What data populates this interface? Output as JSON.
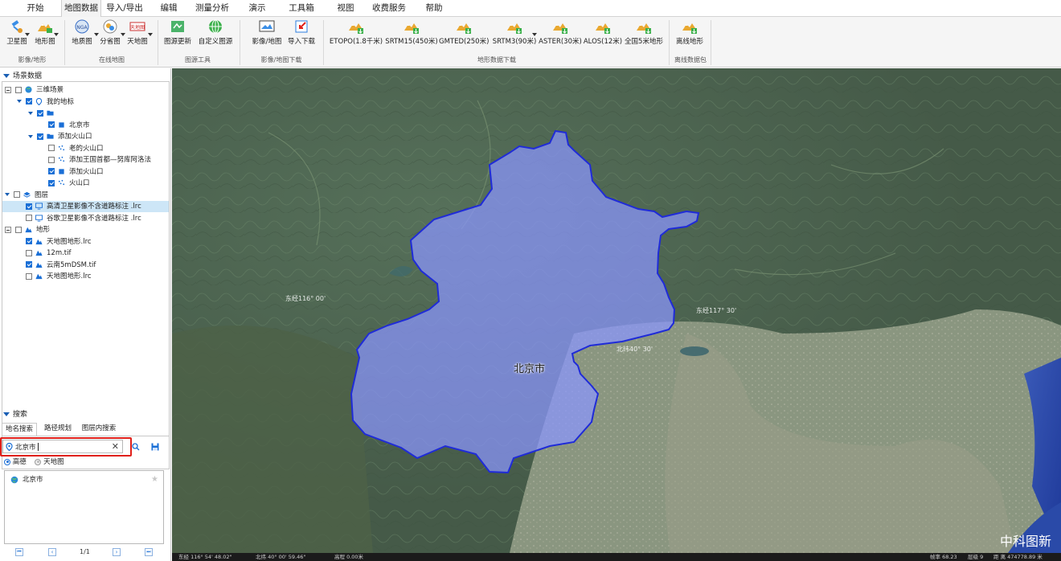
{
  "menu": [
    {
      "label": "开始",
      "active": false
    },
    {
      "label": "地图数据",
      "active": true
    },
    {
      "label": "导入/导出",
      "active": false
    },
    {
      "label": "编辑",
      "active": false
    },
    {
      "label": "测量分析",
      "active": false
    },
    {
      "label": "演示",
      "active": false
    },
    {
      "label": "工具箱",
      "active": false
    },
    {
      "label": "视图",
      "active": false
    },
    {
      "label": "收费服务",
      "active": false
    },
    {
      "label": "帮助",
      "active": false
    }
  ],
  "ribbon": {
    "buttons": [
      {
        "label": "卫星图",
        "icon": "satellite-icon"
      },
      {
        "label": "地形图",
        "icon": "terrain-icon"
      },
      {
        "label": "地质图",
        "icon": "geology-icon"
      },
      {
        "label": "分省图",
        "icon": "province-icon"
      },
      {
        "label": "天地图",
        "icon": "tianditu-icon"
      },
      {
        "label": "图源更新",
        "icon": "map-update-icon"
      },
      {
        "label": "自定义图源",
        "icon": "custom-source-icon"
      },
      {
        "label": "影像/地图",
        "icon": "image-map-icon"
      },
      {
        "label": "导入下载",
        "icon": "import-download-icon"
      },
      {
        "label": "ETOPO(1.8千米)",
        "icon": "terrain-download-icon"
      },
      {
        "label": "SRTM15(450米)",
        "icon": "terrain-download-icon"
      },
      {
        "label": "GMTED(250米)",
        "icon": "terrain-download-icon"
      },
      {
        "label": "SRTM3(90米)",
        "icon": "terrain-download-icon"
      },
      {
        "label": "ASTER(30米)",
        "icon": "terrain-download-icon"
      },
      {
        "label": "ALOS(12米)",
        "icon": "terrain-download-icon"
      },
      {
        "label": "全国5米地形",
        "icon": "terrain-download-icon"
      },
      {
        "label": "离线地形",
        "icon": "terrain-download-icon"
      }
    ],
    "groups": [
      "影像/地形",
      "在线地图",
      "图源工具",
      "影像/地图下载",
      "地形数据下载",
      "离线数据包"
    ]
  },
  "scene": {
    "header": "场景数据",
    "tree": [
      {
        "label": "三维场景",
        "level": 0,
        "check": false,
        "expand": "box",
        "icon": "globe-icon"
      },
      {
        "label": "我的地标",
        "level": 1,
        "check": true,
        "expand": "tri",
        "icon": "pin-icon"
      },
      {
        "label": "",
        "level": 2,
        "check": true,
        "expand": "tri",
        "icon": "folder-icon"
      },
      {
        "label": "北京市",
        "level": 3,
        "check": true,
        "expand": "",
        "icon": "polygon-icon"
      },
      {
        "label": "添加火山口",
        "level": 2,
        "check": true,
        "expand": "tri",
        "icon": "folder-icon"
      },
      {
        "label": "老的火山口",
        "level": 3,
        "check": false,
        "expand": "",
        "icon": "point-icon"
      },
      {
        "label": "添加王国首都—努库阿洛法",
        "level": 3,
        "check": false,
        "expand": "",
        "icon": "point-icon"
      },
      {
        "label": "添加火山口",
        "level": 3,
        "check": true,
        "expand": "",
        "icon": "polygon-icon"
      },
      {
        "label": "火山口",
        "level": 3,
        "check": true,
        "expand": "",
        "icon": "point-icon"
      },
      {
        "label": "图层",
        "level": 0,
        "check": false,
        "expand": "tri",
        "icon": "layers-icon"
      },
      {
        "label": "高清卫星影像不含道路标注 .lrc",
        "level": 1,
        "check": true,
        "expand": "",
        "icon": "monitor-icon",
        "selected": true
      },
      {
        "label": "谷歌卫星影像不含道路标注 .lrc",
        "level": 1,
        "check": false,
        "expand": "",
        "icon": "monitor-icon"
      },
      {
        "label": "地形",
        "level": 0,
        "check": false,
        "expand": "box",
        "icon": "terrain-icon"
      },
      {
        "label": "天地图地形.lrc",
        "level": 1,
        "check": true,
        "expand": "",
        "icon": "terrain-icon"
      },
      {
        "label": "12m.tif",
        "level": 1,
        "check": false,
        "expand": "",
        "icon": "terrain-icon"
      },
      {
        "label": "云南5mDSM.tif",
        "level": 1,
        "check": true,
        "expand": "",
        "icon": "terrain-icon"
      },
      {
        "label": "天地图地形.lrc",
        "level": 1,
        "check": false,
        "expand": "",
        "icon": "terrain-icon"
      }
    ]
  },
  "search": {
    "header": "搜索",
    "tabs": [
      "地名搜索",
      "路径规划",
      "图层内搜索"
    ],
    "input_value": "北京市",
    "sources": [
      "高德",
      "天地图"
    ],
    "selected_source": "高德",
    "results": [
      {
        "label": "北京市"
      }
    ],
    "pager": "1/1"
  },
  "map": {
    "region_label": "北京市",
    "coord_labels": [
      "东经116° 00'",
      "东经117° 30'",
      "北纬40° 30'"
    ],
    "watermark": "中科图新",
    "boundary_color": "#1f2bd8",
    "fill_color": "#8a95ff"
  },
  "status": {
    "lon": "东经 116° 54' 48.02\"",
    "lat": "北纬 40° 00' 59.46\"",
    "elev": "高程 0.00米",
    "fps": "帧率 68.23",
    "level": "层级 9",
    "distance": "距 离 474778.89 米"
  }
}
